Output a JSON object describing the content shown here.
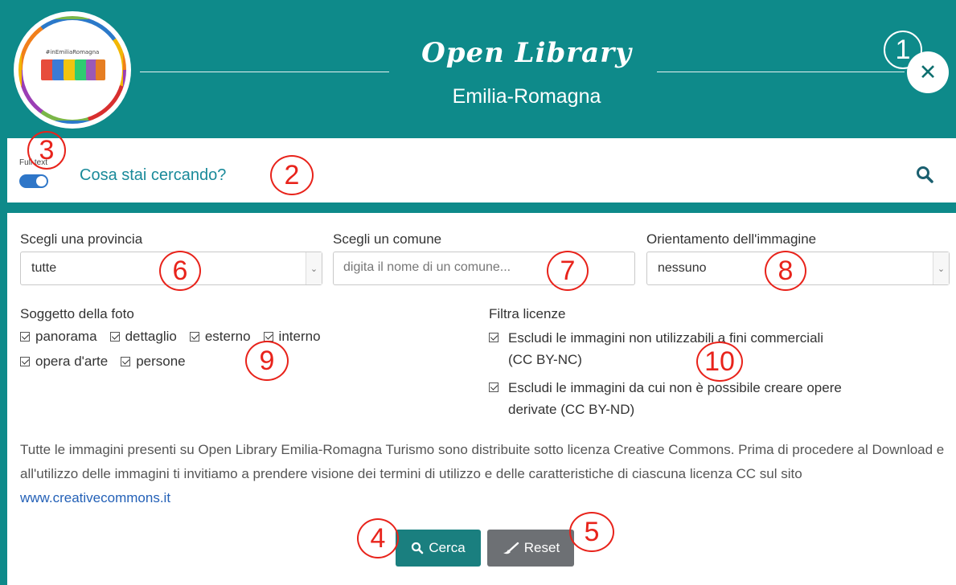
{
  "header": {
    "logo_tag": "#inEmiliaRomagna",
    "title": "Open Library",
    "subtitle": "Emilia-Romagna",
    "close_icon": "close-icon"
  },
  "search": {
    "toggle_label": "Full text",
    "toggle_on": true,
    "placeholder": "Cosa stai cercando?",
    "search_icon": "search-icon"
  },
  "filters": {
    "province": {
      "label": "Scegli una provincia",
      "value": "tutte"
    },
    "comune": {
      "label": "Scegli un comune",
      "placeholder": "digita il nome di un comune..."
    },
    "orientamento": {
      "label": "Orientamento dell'immagine",
      "value": "nessuno"
    },
    "soggetto": {
      "label": "Soggetto della foto",
      "options": [
        "panorama",
        "dettaglio",
        "esterno",
        "interno",
        "opera d'arte",
        "persone"
      ]
    },
    "licenze": {
      "label": "Filtra licenze",
      "options": [
        "Escludi le immagini non utilizzabili a fini commerciali (CC BY-NC)",
        "Escludi le immagini da cui non è possibile creare opere derivate (CC BY-ND)"
      ]
    }
  },
  "notice": {
    "text": "Tutte le immagini presenti su Open Library Emilia-Romagna Turismo sono distribuite sotto licenza Creative Commons. Prima di procedere al Download e all'utilizzo delle immagini ti invitiamo a prendere visione dei termini di utilizzo e delle caratteristiche di ciascuna licenza CC sul sito ",
    "link": "www.creativecommons.it"
  },
  "buttons": {
    "search": "Cerca",
    "reset": "Reset"
  },
  "annotations": [
    "1",
    "2",
    "3",
    "4",
    "5",
    "6",
    "7",
    "8",
    "9",
    "10"
  ],
  "colors": {
    "teal": "#0e8a8a",
    "search_text": "#1a8a9a",
    "button_search": "#1a7f7f",
    "button_reset": "#6d7074",
    "annotation": "#e8231b",
    "link": "#2461b7"
  }
}
